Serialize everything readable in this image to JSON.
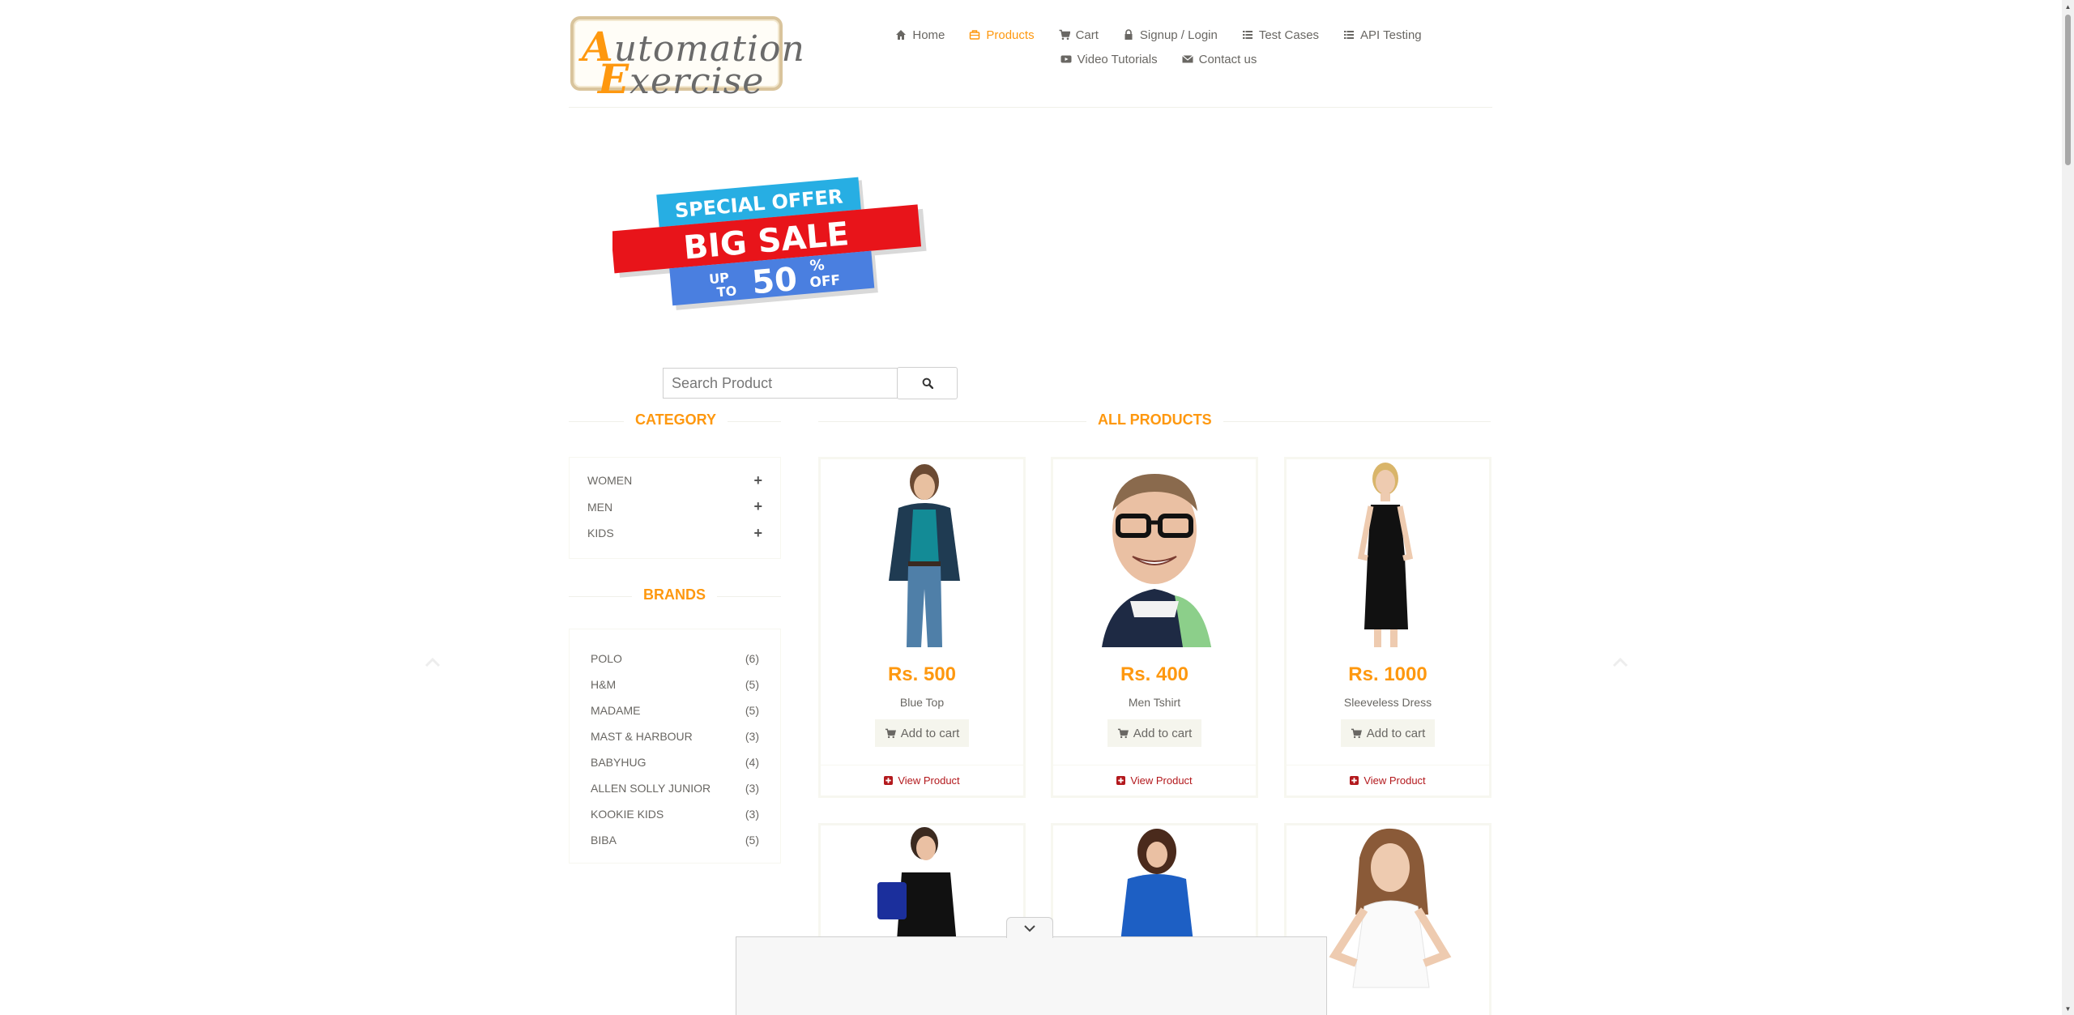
{
  "header": {
    "logo_top": "Automation",
    "logo_bottom": "Exercise",
    "nav": [
      {
        "label": "Home",
        "icon": "home-icon"
      },
      {
        "label": "Products",
        "icon": "products-icon",
        "active": true
      },
      {
        "label": "Cart",
        "icon": "cart-icon"
      },
      {
        "label": "Signup / Login",
        "icon": "lock-icon"
      },
      {
        "label": "Test Cases",
        "icon": "list-icon"
      },
      {
        "label": "API Testing",
        "icon": "list-icon"
      },
      {
        "label": "Video Tutorials",
        "icon": "youtube-icon"
      },
      {
        "label": "Contact us",
        "icon": "envelope-icon"
      }
    ]
  },
  "banner": {
    "line1": "SPECIAL OFFER",
    "line2": "BIG SALE",
    "line3a": "UP",
    "line3b": "TO",
    "line3c": "50",
    "line3d": "%",
    "line3e": "OFF"
  },
  "search": {
    "placeholder": "Search Product"
  },
  "sidebar": {
    "category_title": "Category",
    "categories": [
      "Women",
      "Men",
      "Kids"
    ],
    "brands_title": "Brands",
    "brands": [
      {
        "name": "Polo",
        "count": "(6)"
      },
      {
        "name": "H&M",
        "count": "(5)"
      },
      {
        "name": "Madame",
        "count": "(5)"
      },
      {
        "name": "Mast & Harbour",
        "count": "(3)"
      },
      {
        "name": "Babyhug",
        "count": "(4)"
      },
      {
        "name": "Allen Solly Junior",
        "count": "(3)"
      },
      {
        "name": "Kookie Kids",
        "count": "(3)"
      },
      {
        "name": "Biba",
        "count": "(5)"
      }
    ]
  },
  "products": {
    "title": "All Products",
    "add_label": "Add to cart",
    "view_label": "View Product",
    "items": [
      {
        "price": "Rs. 500",
        "name": "Blue Top"
      },
      {
        "price": "Rs. 400",
        "name": "Men Tshirt"
      },
      {
        "price": "Rs. 1000",
        "name": "Sleeveless Dress"
      }
    ]
  },
  "colors": {
    "accent": "#fe980f",
    "text": "#696763",
    "link": "#b3191d"
  }
}
